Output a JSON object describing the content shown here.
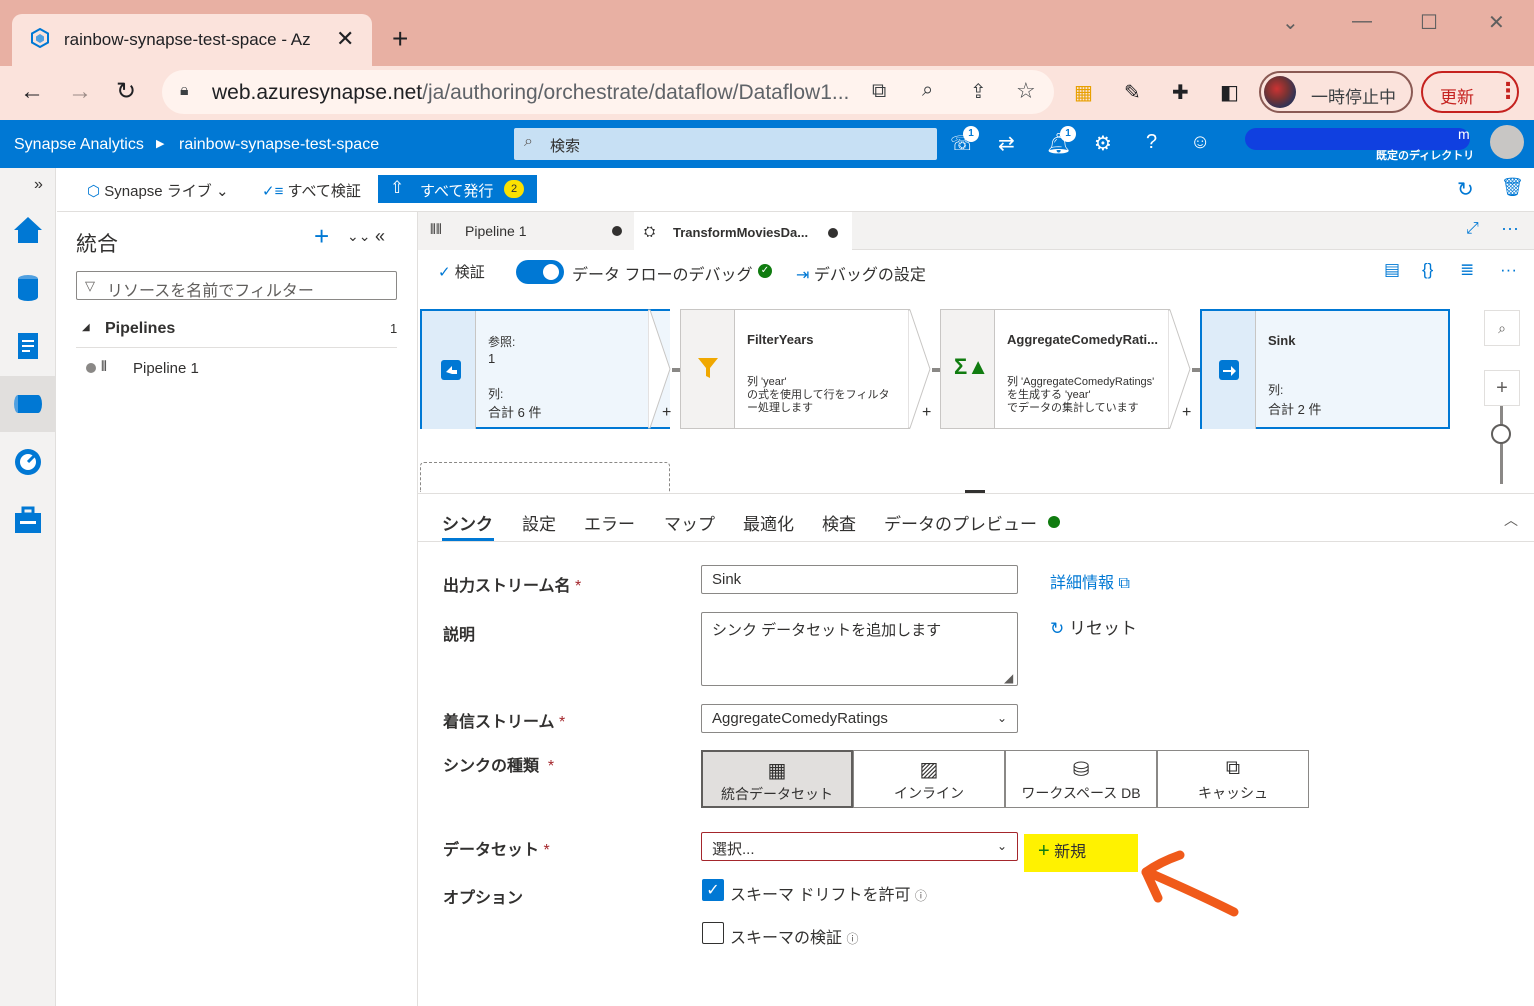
{
  "browser": {
    "tab_title": "rainbow-synapse-test-space - Az",
    "tab_close": "✕",
    "new_tab": "+",
    "url_host": "web.azuresynapse.net",
    "url_path": "/ja/authoring/orchestrate/dataflow/Dataflow1...",
    "profile_status": "一時停止中",
    "update_label": "更新",
    "update_more": "⋮"
  },
  "header": {
    "app_name": "Synapse Analytics",
    "workspace": "rainbow-synapse-test-space",
    "search_placeholder": "検索",
    "feedback_badge": "1",
    "notifications_badge": "1",
    "user_fragment": "m",
    "directory": "既定のディレクトリ"
  },
  "toolbar": {
    "synapse_live": "Synapse ライブ",
    "validate_all": "すべて検証",
    "publish_all": "すべて発行",
    "publish_count": "2"
  },
  "resources": {
    "title": "統合",
    "filter_placeholder": "リソースを名前でフィルター",
    "group_label": "Pipelines",
    "group_count": "1",
    "item_label": "Pipeline 1"
  },
  "editor_tabs": [
    {
      "label": "Pipeline 1"
    },
    {
      "label": "TransformMoviesDa..."
    }
  ],
  "dataflow_toolbar": {
    "validate": "検証",
    "debug_label": "データ フローのデバッグ",
    "debug_settings": "デバッグの設定"
  },
  "nodes": [
    {
      "title": "参照:",
      "value": "1",
      "cols_label": "列:",
      "cols_value": "合計 6 件"
    },
    {
      "title": "FilterYears",
      "line1": "列 'year'",
      "line2": "の式を使用して行をフィルタ",
      "line3": "ー処理します"
    },
    {
      "title": "AggregateComedyRati...",
      "line1": "列 'AggregateComedyRatings'",
      "line2": "を生成する 'year'",
      "line3": "でデータの集計しています"
    },
    {
      "title": "Sink",
      "cols_label": "列:",
      "cols_value": "合計 2 件"
    }
  ],
  "panel_tabs": [
    "シンク",
    "設定",
    "エラー",
    "マップ",
    "最適化",
    "検査",
    "データのプレビュー"
  ],
  "form": {
    "stream_name_label": "出力ストリーム名",
    "stream_name_value": "Sink",
    "learn_more": "詳細情報",
    "description_label": "説明",
    "description_value": "シンク データセットを追加します",
    "reset": "リセット",
    "incoming_label": "着信ストリーム",
    "incoming_value": "AggregateComedyRatings",
    "sink_type_label": "シンクの種類",
    "sink_types": [
      "統合データセット",
      "インライン",
      "ワークスペース DB",
      "キャッシュ"
    ],
    "dataset_label": "データセット",
    "dataset_placeholder": "選択...",
    "new_button": "新規",
    "options_label": "オプション",
    "allow_drift": "スキーマ ドリフトを許可",
    "validate_schema": "スキーマの検証",
    "required_mark": "*"
  },
  "colors": {
    "azure_blue": "#0078d4",
    "highlight": "#fff200",
    "annotation_arrow": "#f05a1a",
    "browser_tabstrip": "#e8b0a3"
  }
}
